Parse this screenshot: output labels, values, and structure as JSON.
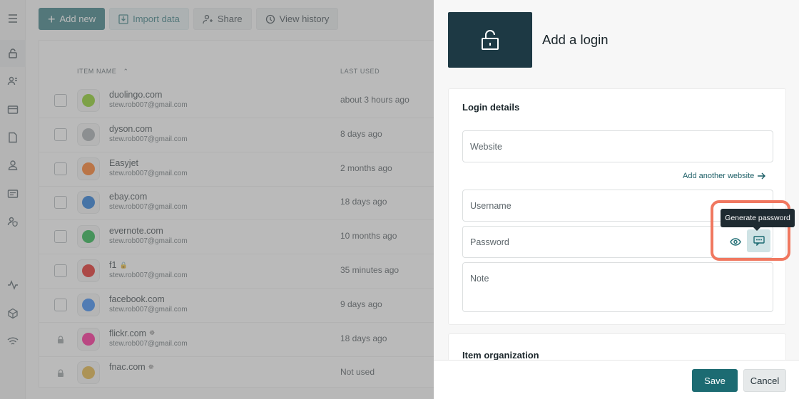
{
  "sidebar": {
    "icons": [
      "menu-icon",
      "lock-icon",
      "users-icon",
      "card-icon",
      "document-icon",
      "person-icon",
      "id-card-icon",
      "person-shield-icon",
      "activity-icon",
      "cube-icon",
      "wifi-icon"
    ]
  },
  "toolbar": {
    "add_new": "Add new",
    "import_data": "Import data",
    "share": "Share",
    "view_history": "View history"
  },
  "list": {
    "col_item_name": "ITEM NAME",
    "col_last_used": "LAST USED",
    "sort_indicator": "^",
    "rows": [
      {
        "name": "duolingo.com",
        "email": "stew.rob007@gmail.com",
        "last_used": "about 3 hours ago",
        "icon": "duolingo-icon",
        "color": "#78c800"
      },
      {
        "name": "dyson.com",
        "email": "stew.rob007@gmail.com",
        "last_used": "8 days ago",
        "icon": "globe-icon",
        "color": "#9aa1a4"
      },
      {
        "name": "Easyjet",
        "email": "stew.rob007@gmail.com",
        "last_used": "2 months ago",
        "icon": "easyjet-icon",
        "color": "#ff6600"
      },
      {
        "name": "ebay.com",
        "email": "stew.rob007@gmail.com",
        "last_used": "18 days ago",
        "icon": "ebay-icon",
        "color": "#0064d2"
      },
      {
        "name": "evernote.com",
        "email": "stew.rob007@gmail.com",
        "last_used": "10 months ago",
        "icon": "evernote-icon",
        "color": "#00a82d"
      },
      {
        "name": "f1",
        "email": "stew.rob007@gmail.com",
        "last_used": "35 minutes ago",
        "icon": "f1-icon",
        "color": "#e10600"
      },
      {
        "name": "facebook.com",
        "email": "stew.rob007@gmail.com",
        "last_used": "9 days ago",
        "icon": "facebook-icon",
        "color": "#1877f2"
      },
      {
        "name": "flickr.com",
        "email": "stew.rob007@gmail.com",
        "last_used": "18 days ago",
        "icon": "flickr-icon",
        "color": "#ff0084"
      },
      {
        "name": "fnac.com",
        "email": "",
        "last_used": "Not used",
        "icon": "fnac-icon",
        "color": "#e1a925"
      }
    ]
  },
  "panel": {
    "title": "Add a login",
    "login_details": "Login details",
    "website_placeholder": "Website",
    "add_another_website": "Add another website",
    "username_placeholder": "Username",
    "password_placeholder": "Password",
    "note_placeholder": "Note",
    "tooltip": "Generate password",
    "item_organization": "Item organization",
    "save": "Save",
    "cancel": "Cancel"
  },
  "colors": {
    "accent": "#1c6b72",
    "highlight": "#f07860",
    "header_tile": "#1d3944"
  }
}
